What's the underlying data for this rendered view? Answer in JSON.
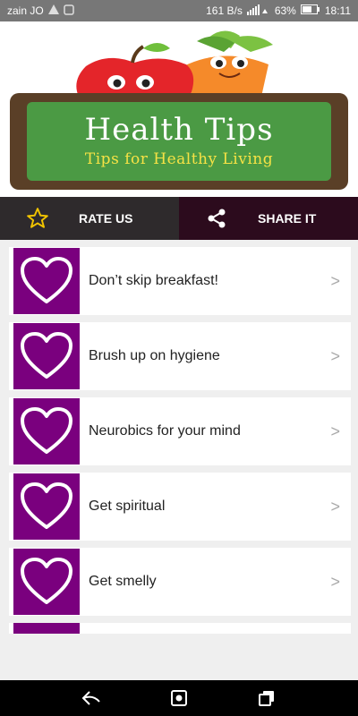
{
  "status_bar": {
    "carrier": "zain JO",
    "network_speed": "161 B/s",
    "battery": "63%",
    "time": "18:11"
  },
  "banner": {
    "title": "Health Tips",
    "subtitle": "Tips for Healthy Living"
  },
  "actions": {
    "rate_label": "RATE US",
    "share_label": "SHARE IT"
  },
  "tips": [
    {
      "label": "Don’t skip breakfast!"
    },
    {
      "label": "Brush up on hygiene"
    },
    {
      "label": "Neurobics for your mind"
    },
    {
      "label": "Get spiritual"
    },
    {
      "label": "Get smelly"
    }
  ],
  "chevron": ">",
  "colors": {
    "accent_purple": "#7a007e",
    "rate_bg": "#2e2a2c",
    "share_bg": "#2c0b1d",
    "sign_green": "#4b9a44"
  },
  "icons": [
    "star-icon",
    "share-icon",
    "heart-icon",
    "back-icon",
    "home-icon",
    "recents-icon"
  ]
}
